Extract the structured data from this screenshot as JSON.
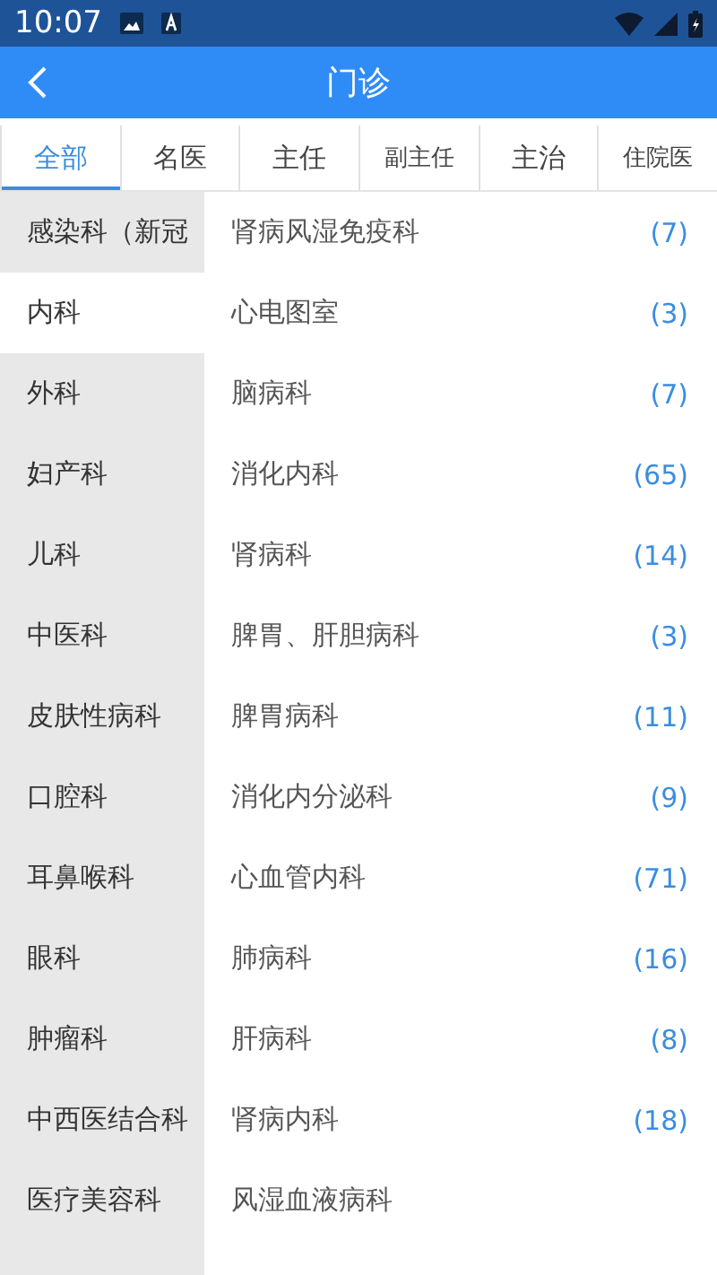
{
  "status_bar": {
    "time": "10:07"
  },
  "header": {
    "title": "门诊"
  },
  "tabs": [
    {
      "label": "全部",
      "selected": true
    },
    {
      "label": "名医",
      "selected": false
    },
    {
      "label": "主任",
      "selected": false
    },
    {
      "label": "副主任",
      "selected": false
    },
    {
      "label": "主治",
      "selected": false
    },
    {
      "label": "住院医",
      "selected": false
    }
  ],
  "departments": [
    {
      "label": "感染科（新冠",
      "selected": false
    },
    {
      "label": "内科",
      "selected": true
    },
    {
      "label": "外科",
      "selected": false
    },
    {
      "label": "妇产科",
      "selected": false
    },
    {
      "label": "儿科",
      "selected": false
    },
    {
      "label": "中医科",
      "selected": false
    },
    {
      "label": "皮肤性病科",
      "selected": false
    },
    {
      "label": "口腔科",
      "selected": false
    },
    {
      "label": "耳鼻喉科",
      "selected": false
    },
    {
      "label": "眼科",
      "selected": false
    },
    {
      "label": "肿瘤科",
      "selected": false
    },
    {
      "label": "中西医结合科",
      "selected": false
    },
    {
      "label": "医疗美容科",
      "selected": false
    }
  ],
  "subdepartments": [
    {
      "label": "肾病风湿免疫科",
      "count": "(7)"
    },
    {
      "label": "心电图室",
      "count": "(3)"
    },
    {
      "label": "脑病科",
      "count": "(7)"
    },
    {
      "label": "消化内科",
      "count": "(65)"
    },
    {
      "label": "肾病科",
      "count": "(14)"
    },
    {
      "label": "脾胃、肝胆病科",
      "count": "(3)"
    },
    {
      "label": "脾胃病科",
      "count": "(11)"
    },
    {
      "label": "消化内分泌科",
      "count": "(9)"
    },
    {
      "label": "心血管内科",
      "count": "(71)"
    },
    {
      "label": "肺病科",
      "count": "(16)"
    },
    {
      "label": "肝病科",
      "count": "(8)"
    },
    {
      "label": "肾病内科",
      "count": "(18)"
    },
    {
      "label": "风湿血液病科"
    }
  ]
}
